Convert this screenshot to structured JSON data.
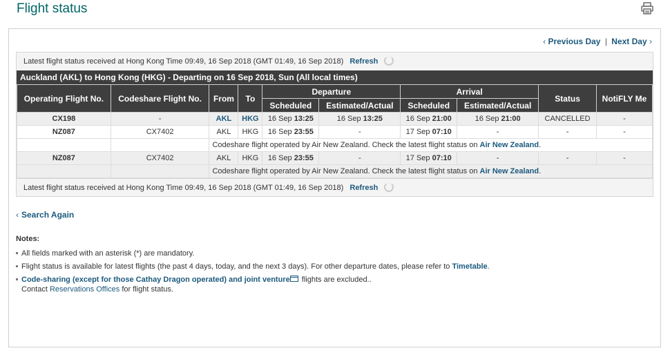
{
  "page": {
    "title": "Flight status",
    "print_icon": "printer-icon"
  },
  "nav": {
    "previous_day": "Previous Day",
    "separator": "|",
    "next_day": "Next Day"
  },
  "latest_status": {
    "text": "Latest flight status received at Hong Kong Time 09:49, 16 Sep 2018 (GMT 01:49, 16 Sep 2018)",
    "refresh": "Refresh"
  },
  "route": {
    "title": "Auckland (AKL) to Hong Kong (HKG) - Departing on 16 Sep 2018, Sun (All local times)"
  },
  "table": {
    "headers": {
      "operating": "Operating Flight No.",
      "codeshare": "Codeshare Flight No.",
      "from": "From",
      "to": "To",
      "departure": "Departure",
      "arrival": "Arrival",
      "scheduled": "Scheduled",
      "estimated": "Estimated/Actual",
      "status": "Status",
      "notifly": "NotiFLY Me"
    },
    "rows": [
      {
        "operating": "CX198",
        "codeshare": "-",
        "from": "AKL",
        "to": "HKG",
        "dep_sched_date": "16 Sep",
        "dep_sched_time": "13:25",
        "dep_est_date": "16 Sep",
        "dep_est_time": "13:25",
        "arr_sched_date": "16 Sep",
        "arr_sched_time": "21:00",
        "arr_est_date": "16 Sep",
        "arr_est_time": "21:00",
        "status": "CANCELLED",
        "notifly": "-"
      },
      {
        "operating": "NZ087",
        "codeshare": "CX7402",
        "from": "AKL",
        "to": "HKG",
        "dep_sched_date": "16 Sep",
        "dep_sched_time": "23:55",
        "dep_est": "-",
        "arr_sched_date": "17 Sep",
        "arr_sched_time": "07:10",
        "arr_est": "-",
        "status": "-",
        "notifly": "-"
      },
      {
        "operating": "NZ087",
        "codeshare": "CX7402",
        "from": "AKL",
        "to": "HKG",
        "dep_sched_date": "16 Sep",
        "dep_sched_time": "23:55",
        "dep_est": "-",
        "arr_sched_date": "17 Sep",
        "arr_sched_time": "07:10",
        "arr_est": "-",
        "status": "-",
        "notifly": "-"
      }
    ],
    "codeshare_note": "Codeshare flight operated by Air New Zealand. Check the latest flight status on",
    "codeshare_link": "Air New Zealand",
    "codeshare_period": "."
  },
  "search_again": "Search Again",
  "notes": {
    "title": "Notes:",
    "item1": "All fields marked with an asterisk (*) are mandatory.",
    "item2_text": "Flight status is available for latest flights (the past 4 days, today, and the next 3 days). For other departure dates, please refer to",
    "item2_link": "Timetable",
    "item2_end": ".",
    "item3_link": "Code-sharing (except for those Cathay Dragon operated) and joint venture",
    "item3_text": "flights are excluded..",
    "item3_line2_pre": "Contact",
    "item3_line2_link": "Reservations Offices",
    "item3_line2_post": "for flight status."
  }
}
